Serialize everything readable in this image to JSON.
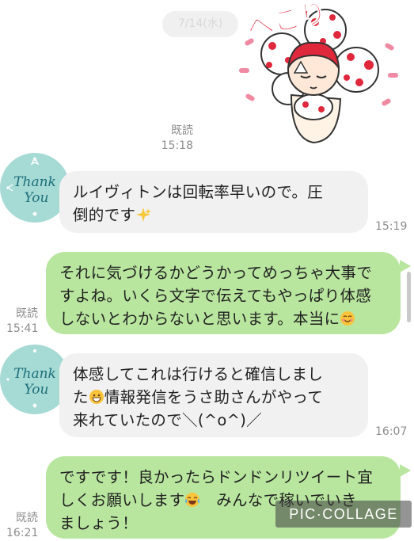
{
  "date_header": "7/14(水)",
  "sticker": {
    "text": "ぺこり"
  },
  "messages": [
    {
      "read": "既読",
      "time": "15:18"
    },
    {
      "lines": [
        "ルイヴィトンは回転率早いので。圧",
        "倒的です"
      ],
      "time": "15:19"
    },
    {
      "lines": [
        "それに気づけるかどうかってめっちゃ大事で",
        "すよね。いくら文字で伝えてもやっぱり体感",
        "しないとわからないと思います。本当に"
      ],
      "read": "既読",
      "time": "15:41"
    },
    {
      "lines": [
        "体感してこれは行けると確信しまし",
        "た",
        "情報発信をうさ助さんがやって",
        "来れていたので＼(^o^)／"
      ],
      "time": "16:07"
    },
    {
      "lines": [
        "ですです！良かったらドンドンリツイート宜",
        "しくお願いします",
        "　みんなで稼いでいき",
        "ましょう！"
      ],
      "read": "既読",
      "time": "16:21"
    }
  ],
  "avatar": {
    "line1": "Thank",
    "line2": "You"
  },
  "icons": [
    "sparkles-emoji",
    "smiling-face-emoji",
    "grinning-face-emoji",
    "tears-of-joy-emoji",
    "thank-you-avatar-icon",
    "bow-sticker-icon"
  ],
  "watermark": "PIC·COLLAGE",
  "colors": {
    "incoming_bubble": "#f1f1f1",
    "outgoing_bubble": "#b9e69f",
    "avatar_bg": "#a6dad5",
    "sticker_red": "#e0283c"
  }
}
